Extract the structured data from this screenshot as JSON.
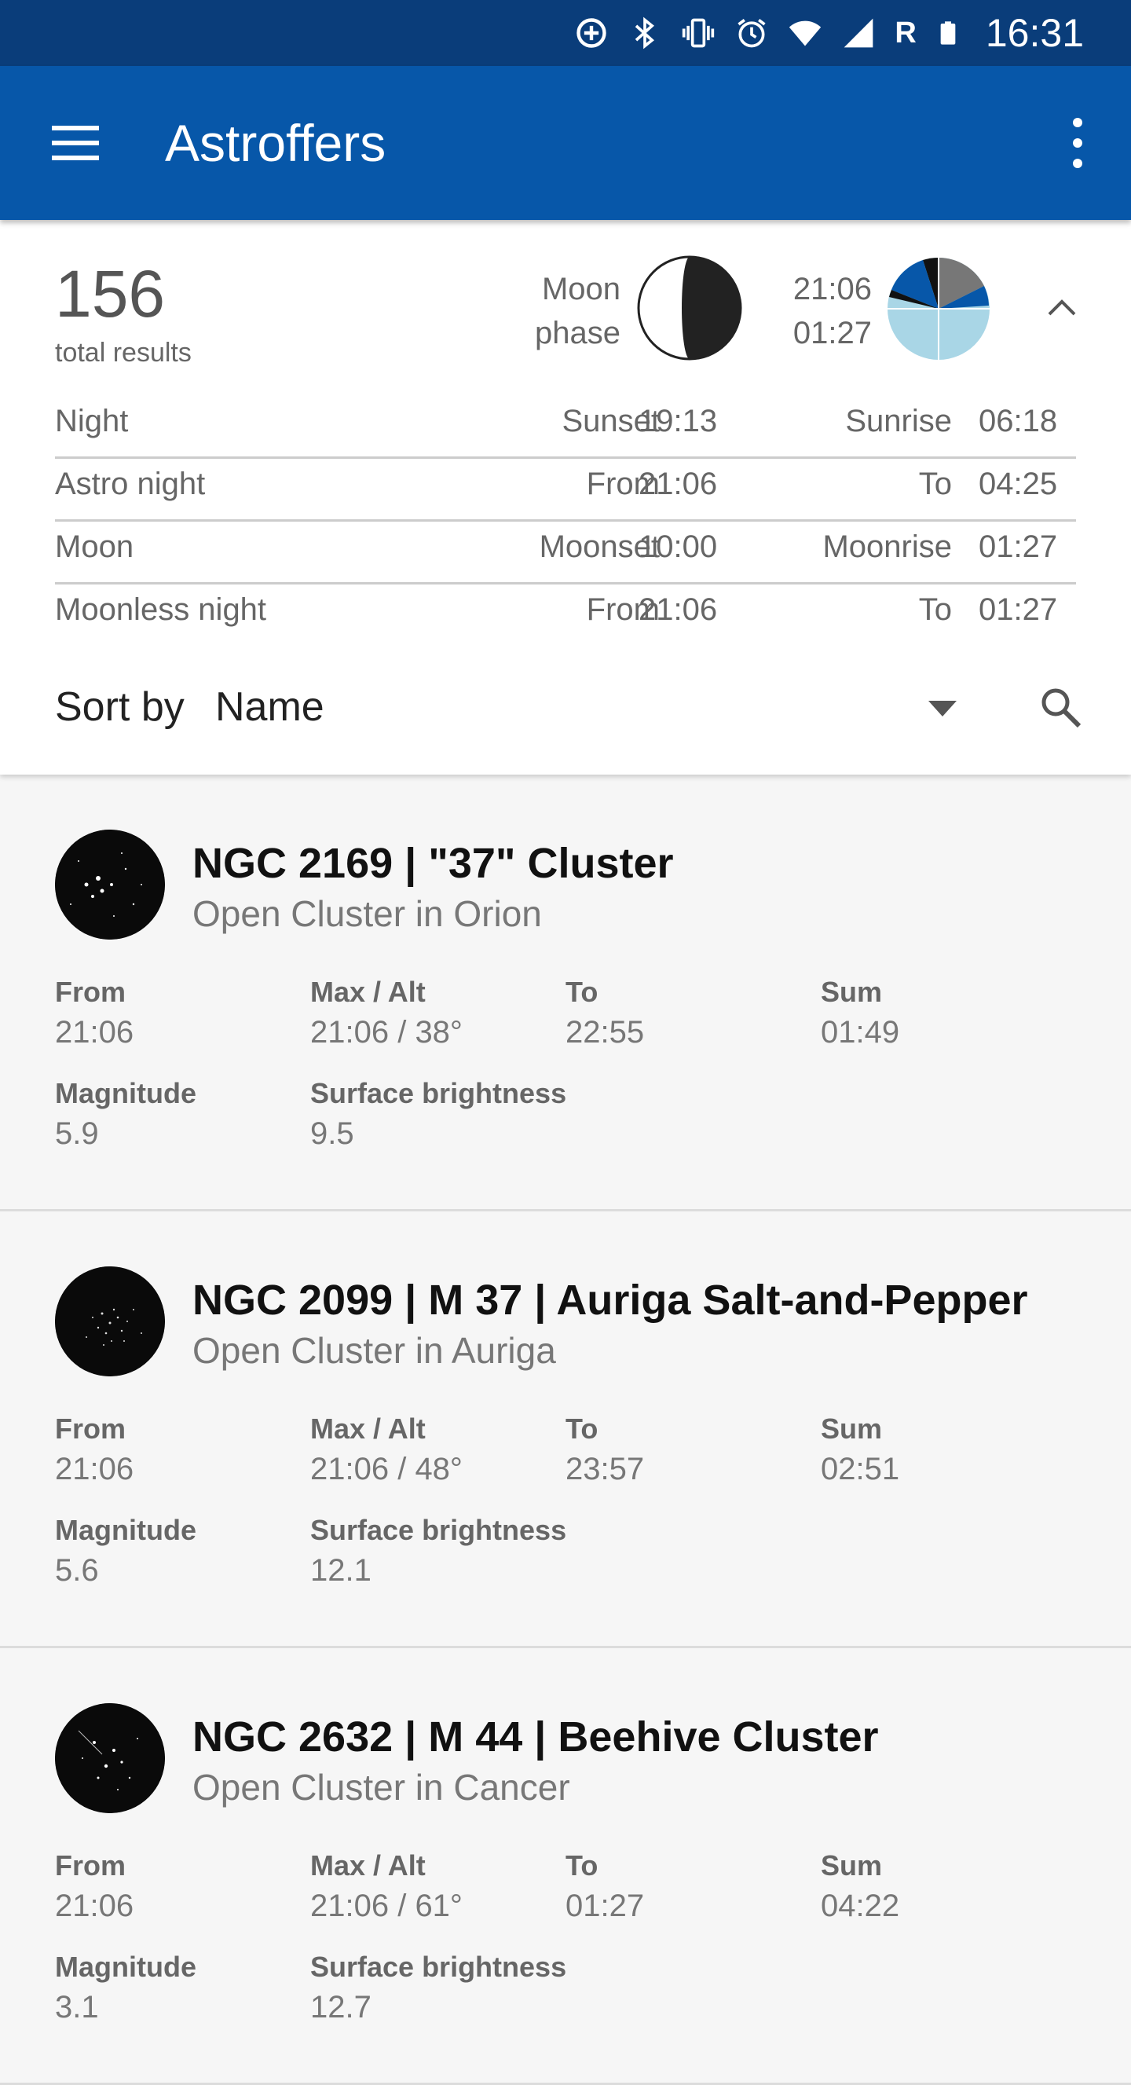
{
  "status_bar": {
    "time": "16:31",
    "roaming": "R",
    "icons": [
      "data-saver-icon",
      "bluetooth-icon",
      "vibrate-icon",
      "alarm-icon",
      "wifi-icon",
      "signal-icon",
      "battery-icon"
    ]
  },
  "app_bar": {
    "title": "Astroffers",
    "icons": [
      "menu-icon",
      "overflow-menu-icon"
    ],
    "color": "#0757a9"
  },
  "summary": {
    "total_count": "156",
    "total_label": "total results",
    "moon_label_1": "Moon",
    "moon_label_2": "phase",
    "time_start": "21:06",
    "time_end": "01:27",
    "rows": [
      {
        "label": "Night",
        "k1": "Sunset",
        "v1": "19:13",
        "k2": "Sunrise",
        "v2": "06:18"
      },
      {
        "label": "Astro night",
        "k1": "From",
        "v1": "21:06",
        "k2": "To",
        "v2": "04:25"
      },
      {
        "label": "Moon",
        "k1": "Moonset",
        "v1": "10:00",
        "k2": "Moonrise",
        "v2": "01:27"
      },
      {
        "label": "Moonless night",
        "k1": "From",
        "v1": "21:06",
        "k2": "To",
        "v2": "01:27"
      }
    ],
    "sort_label": "Sort by",
    "sort_value": "Name"
  },
  "labels": {
    "from": "From",
    "max_alt": "Max / Alt",
    "to": "To",
    "sum": "Sum",
    "magnitude": "Magnitude",
    "surface_brightness": "Surface brightness"
  },
  "results": [
    {
      "title": "NGC 2169 | \"37\" Cluster",
      "subtitle": "Open Cluster in Orion",
      "from": "21:06",
      "max_alt": "21:06 / 38°",
      "to": "22:55",
      "sum": "01:49",
      "magnitude": "5.9",
      "surface_brightness": "9.5"
    },
    {
      "title": "NGC 2099 | M 37 | Auriga Salt-and-Pepper",
      "subtitle": "Open Cluster in Auriga",
      "from": "21:06",
      "max_alt": "21:06 / 48°",
      "to": "23:57",
      "sum": "02:51",
      "magnitude": "5.6",
      "surface_brightness": "12.1"
    },
    {
      "title": "NGC 2632 | M 44 | Beehive Cluster",
      "subtitle": "Open Cluster in Cancer",
      "from": "21:06",
      "max_alt": "21:06 / 61°",
      "to": "01:27",
      "sum": "04:22",
      "magnitude": "3.1",
      "surface_brightness": "12.7"
    }
  ]
}
